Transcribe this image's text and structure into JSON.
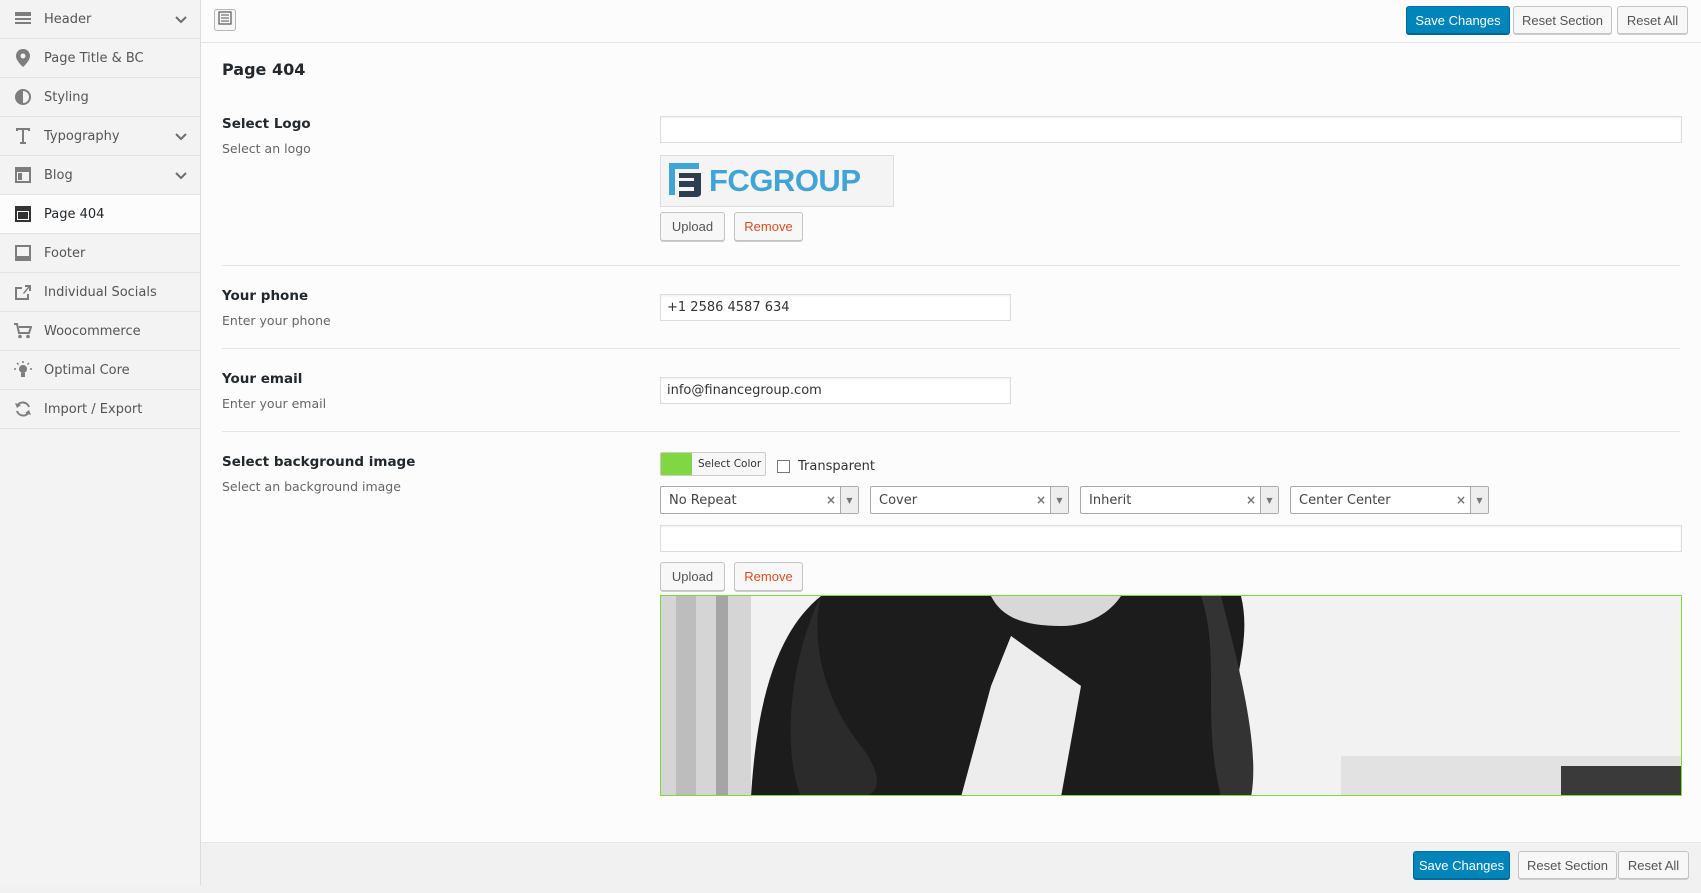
{
  "sidebar": {
    "items": [
      {
        "label": "Header",
        "icon": "header-icon",
        "expandable": true
      },
      {
        "label": "Page Title & BC",
        "icon": "map-pin-icon",
        "expandable": false
      },
      {
        "label": "Styling",
        "icon": "contrast-icon",
        "expandable": false
      },
      {
        "label": "Typography",
        "icon": "text-icon",
        "expandable": true
      },
      {
        "label": "Blog",
        "icon": "layout-icon",
        "expandable": true
      },
      {
        "label": "Page 404",
        "icon": "layout-icon",
        "expandable": false,
        "active": true
      },
      {
        "label": "Footer",
        "icon": "layout-icon",
        "expandable": false
      },
      {
        "label": "Individual Socials",
        "icon": "share-icon",
        "expandable": false
      },
      {
        "label": "Woocommerce",
        "icon": "cart-icon",
        "expandable": false
      },
      {
        "label": "Optimal Core",
        "icon": "lightbulb-icon",
        "expandable": false
      },
      {
        "label": "Import / Export",
        "icon": "refresh-icon",
        "expandable": false
      }
    ]
  },
  "toolbar": {
    "save_label": "Save Changes",
    "reset_section_label": "Reset Section",
    "reset_all_label": "Reset All"
  },
  "page": {
    "title": "Page 404"
  },
  "fields": {
    "logo": {
      "title": "Select Logo",
      "desc": "Select an logo",
      "url_value": "",
      "preview_text": "FCGROUP",
      "upload_label": "Upload",
      "remove_label": "Remove"
    },
    "phone": {
      "title": "Your phone",
      "desc": "Enter your phone",
      "value": "+1 2586 4587 634"
    },
    "email": {
      "title": "Your email",
      "desc": "Enter your email",
      "value": "info@financegroup.com"
    },
    "background": {
      "title": "Select background image",
      "desc": "Select an background image",
      "color_label": "Select Color",
      "color_value": "#81d742",
      "transparent_label": "Transparent",
      "transparent_checked": false,
      "repeat": "No Repeat",
      "size": "Cover",
      "attachment": "Inherit",
      "position": "Center Center",
      "url_value": "",
      "upload_label": "Upload",
      "remove_label": "Remove"
    }
  },
  "colors": {
    "primary": "#0085ba",
    "remove": "#d54e21",
    "swatch": "#81d742"
  }
}
